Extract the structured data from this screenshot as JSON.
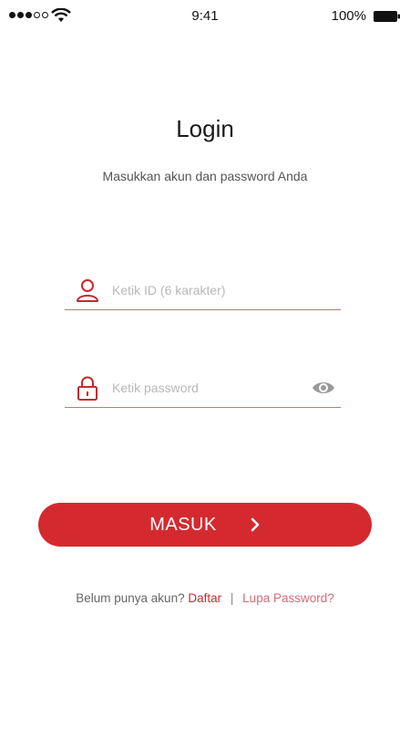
{
  "status_bar": {
    "time": "9:41",
    "battery": "100%",
    "signal_icon": "signal-dots-icon",
    "wifi_icon": "wifi-icon",
    "battery_icon": "battery-icon"
  },
  "header": {
    "title": "Login",
    "subtitle": "Masukkan akun dan password Anda"
  },
  "form": {
    "id_field": {
      "placeholder": "Ketik ID (6 karakter)",
      "value": "",
      "icon": "user-icon"
    },
    "password_field": {
      "placeholder": "Ketik password",
      "value": "",
      "icon": "lock-icon",
      "toggle_icon": "eye-icon"
    },
    "submit": {
      "label": "MASUK",
      "icon": "chevron-right-icon"
    }
  },
  "footer": {
    "prompt": "Belum punya akun?",
    "register_label": "Daftar",
    "separator": "|",
    "forgot_label": "Lupa Password?"
  },
  "colors": {
    "primary": "#d42a2f",
    "underline": "#d56b70",
    "forgot_link": "#d36a78"
  }
}
